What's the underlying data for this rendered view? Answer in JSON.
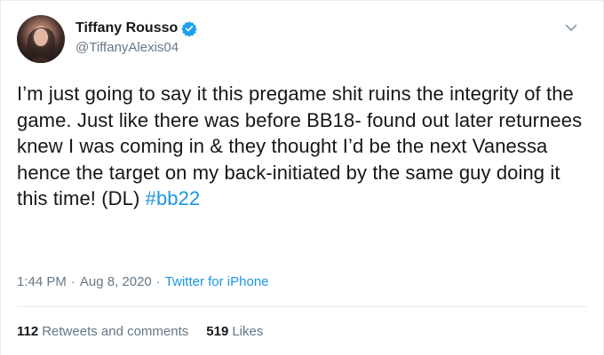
{
  "author": {
    "display_name": "Tiffany Rousso",
    "handle": "@TiffanyAlexis04",
    "verified": true
  },
  "tweet": {
    "text": "I’m just going to say it this pregame shit ruins the integrity of the game. Just like there was before BB18- found out later returnees knew I was coming in & they thought I’d be the next Vanessa hence the target on my back-initiated by the same guy doing it this time! (DL) ",
    "hashtag": "#bb22"
  },
  "meta": {
    "time": "1:44 PM",
    "separator_1": "·",
    "date": "Aug 8, 2020",
    "separator_2": "·",
    "source": "Twitter for iPhone"
  },
  "stats": {
    "retweets_count": "112",
    "retweets_label": "Retweets and comments",
    "likes_count": "519",
    "likes_label": "Likes"
  },
  "icons": {
    "verified": "verified-badge-icon",
    "menu": "chevron-down-icon"
  },
  "colors": {
    "link": "#1b95e0",
    "muted": "#657786",
    "text": "#14171a",
    "divider": "#e6ecf0"
  }
}
